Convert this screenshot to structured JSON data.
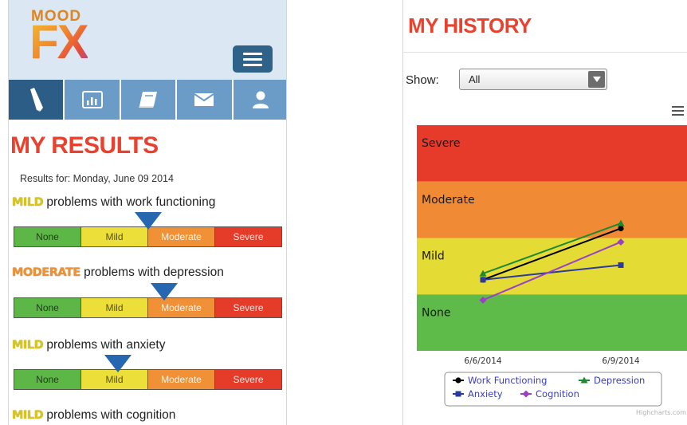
{
  "left": {
    "logo": {
      "top": "MOOD",
      "bottom": "FX"
    },
    "nav_tabs": [
      {
        "icon": "pencil-icon"
      },
      {
        "icon": "bar-chart-icon"
      },
      {
        "icon": "journal-icon"
      },
      {
        "icon": "envelope-icon"
      },
      {
        "icon": "user-icon"
      }
    ],
    "title": "MY RESULTS",
    "results_date": "Results for: Monday, June 09 2014",
    "scale_labels": [
      "None",
      "Mild",
      "Moderate",
      "Severe"
    ],
    "results": [
      {
        "severity": "MILD",
        "text": " problems with work functioning",
        "marker_position": 0.5
      },
      {
        "severity": "MODERATE",
        "text": " problems with depression",
        "marker_position": 0.56
      },
      {
        "severity": "MILD",
        "text": " problems with anxiety",
        "marker_position": 0.39
      },
      {
        "severity": "MILD",
        "text": " problems with cognition"
      }
    ]
  },
  "right": {
    "title": "MY HISTORY",
    "show_label": "Show:",
    "show_value": "All",
    "chart_data": {
      "type": "line",
      "categories": [
        "6/6/2014",
        "6/9/2014"
      ],
      "bands": [
        "Severe",
        "Moderate",
        "Mild",
        "None"
      ],
      "band_colors": [
        "#e63a2b",
        "#f08a35",
        "#e4dc35",
        "#5ebb4a"
      ],
      "ylim": [
        0,
        4
      ],
      "series": [
        {
          "name": "Work Functioning",
          "color": "#000000",
          "marker": "circle",
          "values": [
            1.26,
            2.17
          ]
        },
        {
          "name": "Depression",
          "color": "#1d8a33",
          "marker": "triangle",
          "values": [
            1.37,
            2.26
          ]
        },
        {
          "name": "Anxiety",
          "color": "#2b3a9e",
          "marker": "square",
          "values": [
            1.26,
            1.52
          ]
        },
        {
          "name": "Cognition",
          "color": "#9b3fc7",
          "marker": "diamond",
          "values": [
            0.9,
            1.93
          ]
        }
      ],
      "legend_position": "bottom",
      "credits": "Highcharts.com"
    }
  }
}
